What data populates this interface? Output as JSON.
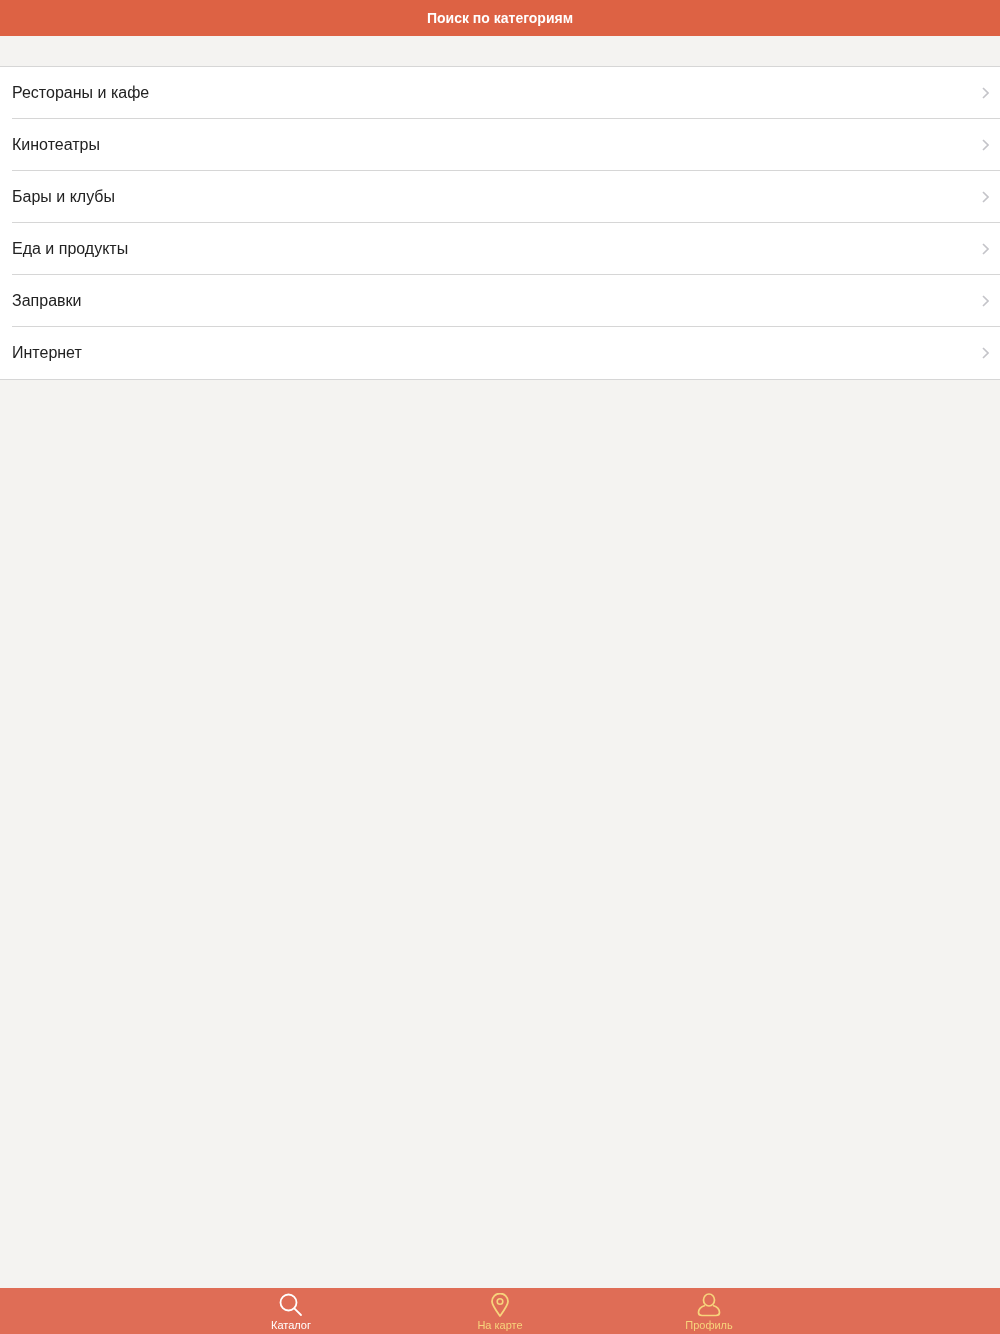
{
  "header": {
    "title": "Поиск по категориям"
  },
  "categories": [
    {
      "label": "Рестораны и кафе"
    },
    {
      "label": "Кинотеатры"
    },
    {
      "label": "Бары и клубы"
    },
    {
      "label": "Еда и продукты"
    },
    {
      "label": "Заправки"
    },
    {
      "label": "Интернет"
    }
  ],
  "tab_bar": [
    {
      "label": "Каталог",
      "kind": "search",
      "selected": true
    },
    {
      "label": "На карте",
      "kind": "pin",
      "selected": false
    },
    {
      "label": "Профиль",
      "kind": "person",
      "selected": false
    }
  ]
}
